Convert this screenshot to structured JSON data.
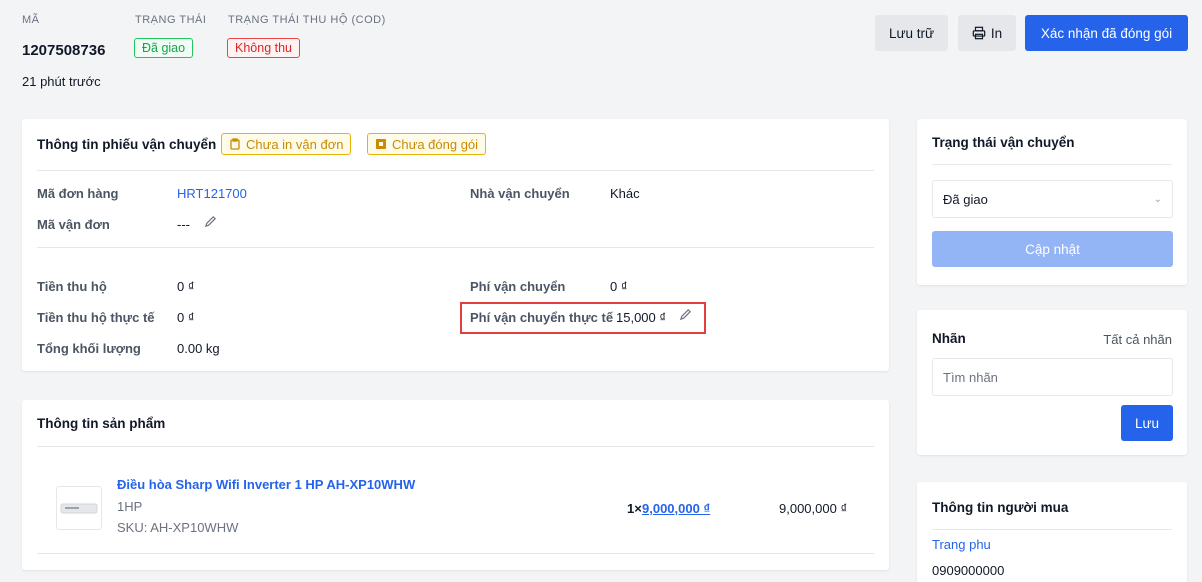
{
  "header": {
    "code_label": "MÃ",
    "code_value": "1207508736",
    "status_label": "TRẠNG THÁI",
    "status_value": "Đã giao",
    "cod_label": "TRẠNG THÁI THU HỘ (COD)",
    "cod_value": "Không thu",
    "time_ago": "21 phút trước"
  },
  "actions": {
    "archive": "Lưu trữ",
    "print": "In",
    "confirm": "Xác nhận đã đóng gói"
  },
  "shipment": {
    "title": "Thông tin phiếu vận chuyển",
    "tag_not_printed": "Chưa in vận đơn",
    "tag_not_packed": "Chưa đóng gói",
    "order_code_label": "Mã đơn hàng",
    "order_code_value": "HRT121700",
    "tracking_label": "Mã vận đơn",
    "tracking_value": "---",
    "carrier_label": "Nhà vận chuyển",
    "carrier_value": "Khác",
    "cod_label": "Tiền thu hộ",
    "cod_value": "0 ₫",
    "cod_actual_label": "Tiền thu hộ thực tế",
    "cod_actual_value": "0 ₫",
    "weight_label": "Tổng khối lượng",
    "weight_value": "0.00 kg",
    "fee_label": "Phí vận chuyển",
    "fee_value": "0 ₫",
    "fee_actual_label": "Phí vận chuyển thực tế",
    "fee_actual_value": "15,000 ₫"
  },
  "products": {
    "title": "Thông tin sản phẩm",
    "items": [
      {
        "name": "Điều hòa Sharp Wifi Inverter 1 HP AH-XP10WHW",
        "variant": "1HP",
        "sku": "SKU: AH-XP10WHW",
        "qty": "1×",
        "unit_price": "9,000,000 ₫",
        "total": "9,000,000 ₫"
      }
    ]
  },
  "shipping_status": {
    "title": "Trạng thái vận chuyển",
    "selected": "Đã giao",
    "update_button": "Cập nhật"
  },
  "labels": {
    "title": "Nhãn",
    "all_labels": "Tất cả nhãn",
    "search_placeholder": "Tìm nhãn",
    "save_button": "Lưu"
  },
  "buyer": {
    "title": "Thông tin người mua",
    "name": "Trang phu",
    "phone": "0909000000"
  }
}
